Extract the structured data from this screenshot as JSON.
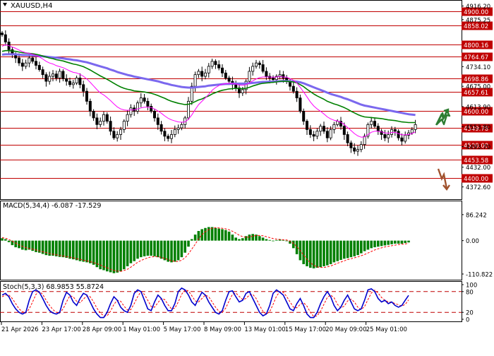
{
  "symbol_label": "XAUUSD,H4",
  "colors": {
    "candle": "#000000",
    "ema_fast": "#ff00ff",
    "ema_mid": "#008000",
    "ema_slow": "#7b68ee",
    "level_line": "#c00000",
    "level_box": "#c00000",
    "macd_hist": "#008000",
    "macd_signal": "#ff0000",
    "stoch_main": "#0000cd",
    "stoch_signal": "#ff0000",
    "stoch_levels": "#c00000",
    "arrow_up": "#2e7d32",
    "arrow_down": "#a0522d",
    "grid": "#000000"
  },
  "chart_data": [
    {
      "type": "line",
      "panel": "price",
      "title": "XAUUSD,H4",
      "ylim": [
        4340,
        4930
      ],
      "y_ticks": [
        "4916.20",
        "4875.25",
        "4734.10",
        "4675.00",
        "4613.90",
        "4553.80",
        "4493.70",
        "4432.00",
        "4372.60"
      ],
      "y_tick_values": [
        4916.2,
        4875.25,
        4734.1,
        4675.0,
        4613.9,
        4553.8,
        4493.7,
        4432.0,
        4372.6
      ],
      "levels": [
        "4900.00",
        "4858.02",
        "4800.16",
        "4764.67",
        "4698.86",
        "4657.61",
        "4600.00",
        "4549.78",
        "4500.00",
        "4453.58",
        "4400.00"
      ],
      "level_values": [
        4900.0,
        4858.02,
        4800.16,
        4764.67,
        4698.86,
        4657.61,
        4600.0,
        4549.78,
        4500.0,
        4453.58,
        4400.0
      ],
      "close": [
        4830,
        4808,
        4785,
        4770,
        4760,
        4745,
        4735,
        4745,
        4760,
        4750,
        4738,
        4725,
        4710,
        4690,
        4705,
        4712,
        4700,
        4720,
        4698,
        4690,
        4680,
        4685,
        4700,
        4680,
        4660,
        4630,
        4600,
        4580,
        4560,
        4570,
        4590,
        4570,
        4540,
        4520,
        4530,
        4545,
        4570,
        4590,
        4610,
        4600,
        4625,
        4640,
        4630,
        4615,
        4600,
        4580,
        4560,
        4540,
        4525,
        4518,
        4530,
        4545,
        4550,
        4560,
        4580,
        4630,
        4675,
        4710,
        4720,
        4705,
        4715,
        4735,
        4750,
        4740,
        4730,
        4715,
        4700,
        4690,
        4680,
        4670,
        4655,
        4665,
        4690,
        4720,
        4735,
        4745,
        4740,
        4720,
        4705,
        4700,
        4695,
        4705,
        4710,
        4700,
        4690,
        4675,
        4660,
        4640,
        4600,
        4570,
        4545,
        4530,
        4525,
        4540,
        4555,
        4540,
        4520,
        4545,
        4560,
        4570,
        4555,
        4530,
        4505,
        4490,
        4480,
        4485,
        4500,
        4525,
        4560,
        4570,
        4555,
        4540,
        4530,
        4520,
        4530,
        4545,
        4540,
        4520,
        4510,
        4528,
        4535,
        4545,
        4560
      ],
      "series": [
        {
          "name": "",
          "key": "ema_fast",
          "values": [
            4795,
            4800,
            4797,
            4793,
            4789,
            4784,
            4779,
            4776,
            4774,
            4771,
            4768,
            4763,
            4757,
            4750,
            4745,
            4742,
            4737,
            4734,
            4731,
            4726,
            4721,
            4717,
            4715,
            4711,
            4705,
            4697,
            4687,
            4676,
            4665,
            4655,
            4649,
            4641,
            4632,
            4622,
            4613,
            4607,
            4604,
            4603,
            4604,
            4604,
            4607,
            4610,
            4612,
            4612,
            4611,
            4607,
            4601,
            4594,
            4586,
            4579,
            4574,
            4571,
            4568,
            4567,
            4568,
            4576,
            4589,
            4605,
            4620,
            4630,
            4640,
            4651,
            4663,
            4671,
            4677,
            4681,
            4683,
            4684,
            4683,
            4682,
            4679,
            4678,
            4680,
            4685,
            4691,
            4697,
            4701,
            4703,
            4703,
            4703,
            4702,
            4703,
            4704,
            4703,
            4702,
            4698,
            4693,
            4685,
            4672,
            4658,
            4643,
            4628,
            4616,
            4607,
            4600,
            4592,
            4583,
            4577,
            4573,
            4571,
            4567,
            4560,
            4551,
            4542,
            4533,
            4526,
            4522,
            4523,
            4530,
            4537,
            4540,
            4540,
            4538,
            4535,
            4534,
            4536,
            4537,
            4533,
            4529,
            4529,
            4530,
            4533,
            4538
          ]
        },
        {
          "name": "",
          "key": "ema_mid",
          "values": [
            4780,
            4782,
            4782,
            4781,
            4780,
            4778,
            4776,
            4775,
            4774,
            4773,
            4771,
            4769,
            4766,
            4763,
            4760,
            4758,
            4755,
            4753,
            4751,
            4748,
            4745,
            4742,
            4740,
            4737,
            4734,
            4729,
            4724,
            4718,
            4712,
            4706,
            4701,
            4696,
            4690,
            4684,
            4678,
            4673,
            4669,
            4666,
            4664,
            4661,
            4660,
            4659,
            4658,
            4656,
            4654,
            4651,
            4647,
            4643,
            4639,
            4634,
            4630,
            4627,
            4624,
            4622,
            4620,
            4621,
            4624,
            4629,
            4634,
            4637,
            4642,
            4646,
            4652,
            4656,
            4660,
            4663,
            4665,
            4667,
            4668,
            4669,
            4668,
            4668,
            4669,
            4672,
            4676,
            4679,
            4682,
            4684,
            4685,
            4686,
            4687,
            4688,
            4690,
            4690,
            4690,
            4689,
            4688,
            4685,
            4680,
            4674,
            4666,
            4659,
            4652,
            4646,
            4641,
            4636,
            4630,
            4626,
            4622,
            4619,
            4615,
            4611,
            4606,
            4600,
            4595,
            4590,
            4586,
            4583,
            4582,
            4581,
            4580,
            4579,
            4578,
            4576,
            4574,
            4573,
            4572,
            4570,
            4568,
            4567,
            4566,
            4566,
            4566
          ]
        },
        {
          "name": "",
          "key": "ema_slow",
          "values": [
            4770,
            4771,
            4771,
            4771,
            4771,
            4770,
            4769,
            4769,
            4769,
            4768,
            4767,
            4766,
            4765,
            4764,
            4763,
            4762,
            4761,
            4760,
            4759,
            4757,
            4756,
            4754,
            4753,
            4751,
            4749,
            4747,
            4744,
            4741,
            4738,
            4735,
            4732,
            4729,
            4725,
            4722,
            4718,
            4715,
            4712,
            4709,
            4707,
            4704,
            4702,
            4700,
            4698,
            4696,
            4694,
            4692,
            4690,
            4687,
            4684,
            4682,
            4679,
            4677,
            4675,
            4673,
            4672,
            4671,
            4671,
            4672,
            4673,
            4674,
            4675,
            4677,
            4678,
            4679,
            4680,
            4681,
            4682,
            4682,
            4683,
            4683,
            4683,
            4683,
            4683,
            4684,
            4685,
            4686,
            4687,
            4688,
            4688,
            4689,
            4689,
            4690,
            4690,
            4691,
            4691,
            4690,
            4690,
            4689,
            4687,
            4684,
            4680,
            4676,
            4672,
            4668,
            4664,
            4660,
            4656,
            4652,
            4649,
            4646,
            4643,
            4639,
            4636,
            4632,
            4628,
            4624,
            4620,
            4617,
            4615,
            4613,
            4611,
            4609,
            4607,
            4605,
            4603,
            4601,
            4599,
            4597,
            4595,
            4593,
            4591,
            4590,
            4589
          ]
        }
      ]
    },
    {
      "type": "bar",
      "panel": "macd",
      "title": "MACD(5,34,4) -6.087 -17.529",
      "ylim": [
        -125,
        100
      ],
      "y_ticks": [
        "86.242",
        "0.00",
        "-110.822"
      ],
      "y_tick_values": [
        86.242,
        0,
        -110.822
      ],
      "values": [
        8,
        5,
        -5,
        -15,
        -22,
        -25,
        -30,
        -32,
        -30,
        -34,
        -38,
        -40,
        -44,
        -48,
        -50,
        -50,
        -52,
        -54,
        -55,
        -57,
        -60,
        -62,
        -65,
        -68,
        -70,
        -72,
        -75,
        -80,
        -88,
        -95,
        -98,
        -102,
        -105,
        -108,
        -106,
        -102,
        -95,
        -85,
        -75,
        -68,
        -60,
        -55,
        -52,
        -50,
        -50,
        -52,
        -55,
        -60,
        -65,
        -70,
        -72,
        -70,
        -65,
        -55,
        -40,
        -20,
        5,
        20,
        32,
        38,
        42,
        45,
        45,
        42,
        40,
        38,
        35,
        30,
        20,
        10,
        5,
        8,
        15,
        20,
        22,
        20,
        15,
        10,
        5,
        2,
        0,
        2,
        4,
        2,
        0,
        -10,
        -25,
        -45,
        -65,
        -78,
        -85,
        -90,
        -92,
        -90,
        -88,
        -85,
        -82,
        -78,
        -72,
        -68,
        -64,
        -60,
        -58,
        -55,
        -52,
        -48,
        -42,
        -35,
        -30,
        -25,
        -22,
        -20,
        -18,
        -16,
        -14,
        -12,
        -10,
        -10,
        -10,
        -8,
        -6
      ],
      "signal": [
        10,
        8,
        4,
        -2,
        -8,
        -14,
        -19,
        -23,
        -26,
        -28,
        -31,
        -34,
        -37,
        -40,
        -43,
        -45,
        -47,
        -49,
        -51,
        -53,
        -55,
        -57,
        -60,
        -62,
        -65,
        -67,
        -70,
        -73,
        -77,
        -81,
        -86,
        -90,
        -95,
        -99,
        -101,
        -102,
        -99,
        -95,
        -88,
        -80,
        -72,
        -66,
        -61,
        -57,
        -54,
        -53,
        -53,
        -56,
        -59,
        -63,
        -67,
        -69,
        -69,
        -65,
        -57,
        -44,
        -28,
        -12,
        6,
        20,
        30,
        37,
        41,
        43,
        42,
        41,
        39,
        36,
        31,
        25,
        18,
        13,
        11,
        12,
        15,
        17,
        17,
        16,
        13,
        10,
        7,
        5,
        4,
        3,
        2,
        -2,
        -9,
        -20,
        -33,
        -48,
        -62,
        -73,
        -82,
        -87,
        -89,
        -89,
        -87,
        -84,
        -80,
        -75,
        -71,
        -67,
        -63,
        -60,
        -57,
        -54,
        -50,
        -46,
        -41,
        -36,
        -31,
        -27,
        -24,
        -21,
        -19,
        -17,
        -15,
        -13,
        -12,
        -11,
        -9
      ]
    },
    {
      "type": "line",
      "panel": "stochastic",
      "title": "Stoch(5,3,3) 68.9853 55.8724",
      "ylim": [
        0,
        100
      ],
      "y_ticks": [
        "100",
        "80",
        "20",
        "0"
      ],
      "y_tick_values": [
        100,
        80,
        20,
        0
      ],
      "levels": [
        80,
        20
      ],
      "series": [
        {
          "name": "",
          "key": "stoch_main",
          "values": [
            70,
            75,
            65,
            45,
            30,
            20,
            15,
            20,
            55,
            80,
            85,
            78,
            60,
            40,
            25,
            18,
            15,
            20,
            55,
            78,
            70,
            50,
            40,
            60,
            75,
            70,
            50,
            30,
            15,
            5,
            5,
            20,
            45,
            65,
            55,
            35,
            25,
            20,
            40,
            75,
            85,
            80,
            55,
            30,
            25,
            50,
            70,
            60,
            40,
            25,
            25,
            45,
            80,
            90,
            85,
            70,
            50,
            40,
            60,
            78,
            70,
            50,
            35,
            20,
            15,
            25,
            55,
            80,
            82,
            65,
            50,
            55,
            75,
            80,
            60,
            40,
            20,
            10,
            15,
            40,
            75,
            85,
            78,
            70,
            50,
            30,
            25,
            45,
            60,
            40,
            15,
            5,
            5,
            20,
            45,
            65,
            80,
            65,
            40,
            25,
            35,
            55,
            70,
            50,
            30,
            25,
            30,
            55,
            85,
            88,
            80,
            60,
            50,
            55,
            45,
            50,
            40,
            35,
            40,
            55,
            69
          ]
        },
        {
          "name": "",
          "key": "stoch_signal",
          "values": [
            65,
            70,
            70,
            60,
            45,
            30,
            22,
            18,
            30,
            50,
            72,
            80,
            72,
            55,
            40,
            28,
            20,
            18,
            30,
            50,
            68,
            65,
            52,
            48,
            58,
            68,
            65,
            50,
            32,
            18,
            10,
            10,
            23,
            43,
            55,
            52,
            38,
            27,
            28,
            45,
            65,
            80,
            72,
            55,
            37,
            35,
            48,
            60,
            57,
            42,
            30,
            32,
            50,
            72,
            85,
            82,
            68,
            53,
            50,
            60,
            70,
            65,
            50,
            35,
            23,
            20,
            32,
            53,
            72,
            76,
            66,
            57,
            60,
            70,
            72,
            60,
            40,
            23,
            15,
            22,
            43,
            67,
            80,
            78,
            66,
            50,
            35,
            33,
            43,
            48,
            38,
            20,
            8,
            10,
            23,
            43,
            63,
            70,
            62,
            43,
            33,
            38,
            53,
            58,
            50,
            35,
            28,
            37,
            57,
            76,
            84,
            76,
            63,
            55,
            50,
            50,
            45,
            42,
            38,
            43,
            56
          ]
        }
      ]
    }
  ],
  "x_axis": {
    "labels": [
      "21 Apr 2026",
      "23 Apr 17:00",
      "28 Apr 09:00",
      "1 May 01:00",
      "5 May 17:00",
      "8 May 09:00",
      "13 May 01:00",
      "15 May 17:00",
      "20 May 09:00",
      "25 May 01:00"
    ],
    "label_bar_index": [
      0,
      15,
      30,
      45,
      60,
      75,
      90,
      105,
      120,
      135
    ]
  }
}
